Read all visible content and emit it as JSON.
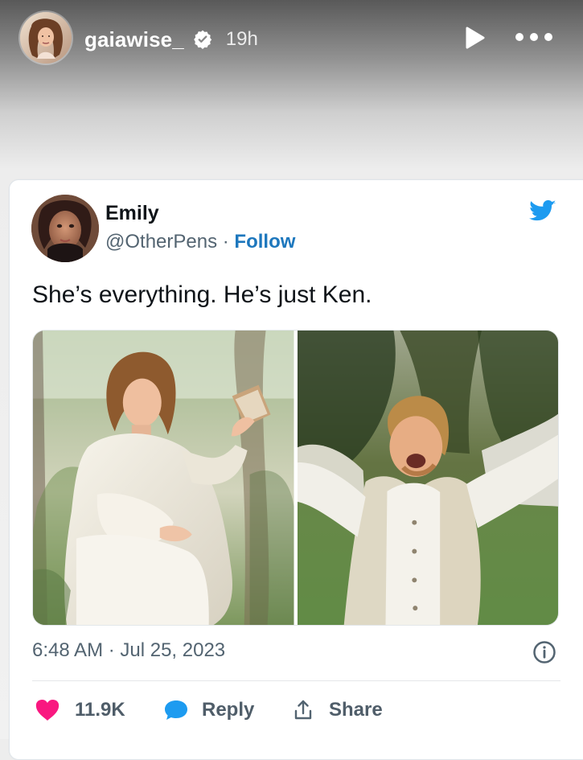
{
  "story": {
    "username": "gaiawise_",
    "time": "19h"
  },
  "tweet": {
    "author_name": "Emily",
    "handle": "@OtherPens",
    "separator": " · ",
    "follow_label": "Follow",
    "text": "She’s everything. He’s just Ken.",
    "timestamp": "6:48 AM · Jul 25, 2023",
    "likes": "11.9K",
    "reply_label": "Reply",
    "share_label": "Share"
  },
  "colors": {
    "follow_blue": "#1d77bd",
    "twitter_blue": "#1d9bf0",
    "like_pink": "#f91880",
    "reply_blue": "#1d9bf0",
    "text_dark": "#0f1419",
    "text_gray": "#536471"
  },
  "icons": {
    "verified": "verified-icon",
    "play": "play-icon",
    "more": "more-icon",
    "twitter": "twitter-bird-icon",
    "info": "info-icon",
    "like": "heart-icon",
    "reply": "speech-bubble-icon",
    "share": "share-icon"
  }
}
